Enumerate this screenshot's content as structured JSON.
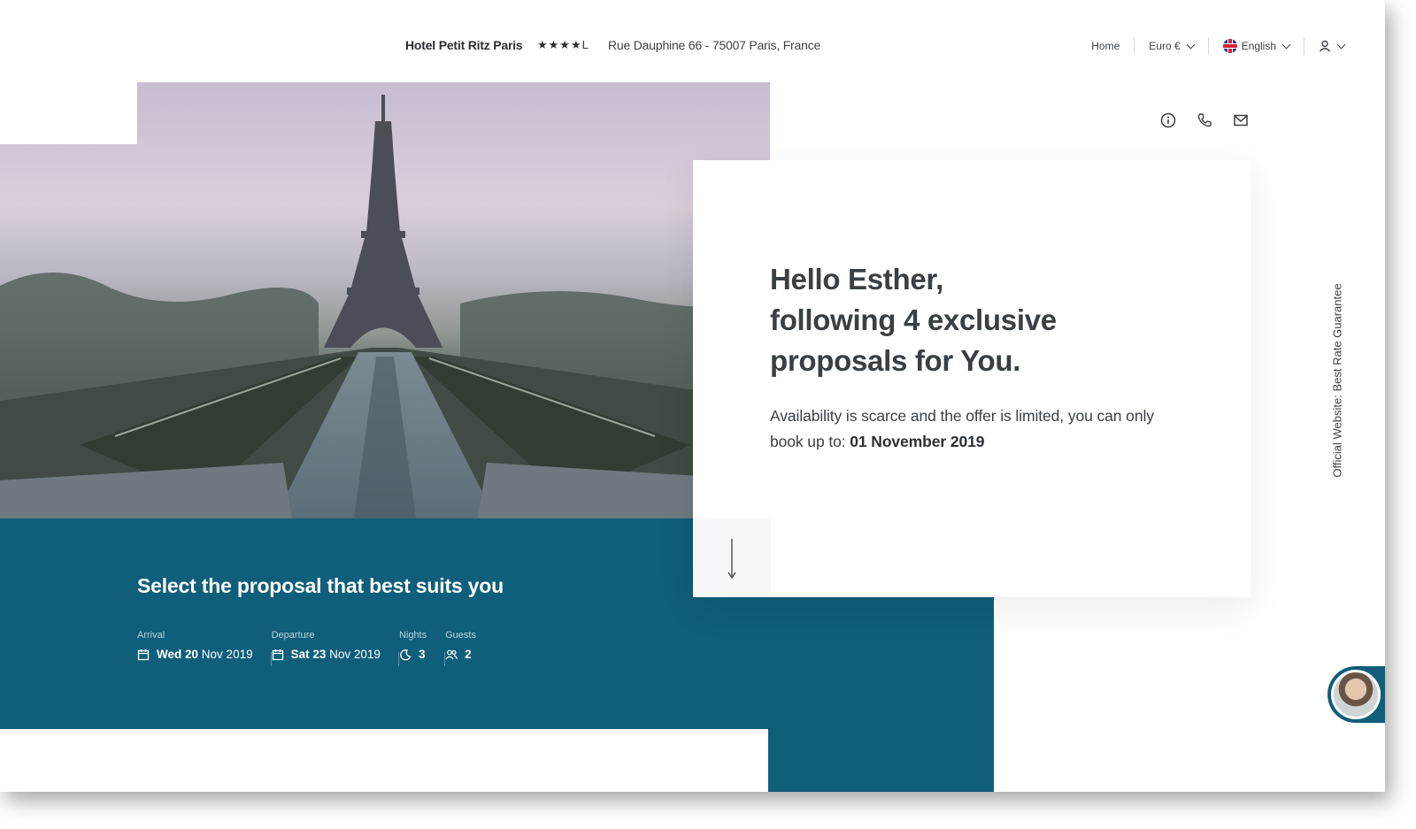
{
  "header": {
    "hotel_name": "Hotel Petit Ritz Paris",
    "stars": "★★★★L",
    "address": "Rue Dauphine 66 - 75007 Paris, France",
    "nav": {
      "home": "Home",
      "currency": "Euro €",
      "language": "English"
    }
  },
  "hero": {
    "image_subject": "Eiffel Tower at dawn",
    "greeting_line1": "Hello Esther,",
    "greeting_line2": "following 4 exclusive",
    "greeting_line3": "proposals for You.",
    "availability_text": "Availability is scarce and the offer is limited, you can only book up to:",
    "availability_date": "01 November 2019"
  },
  "booking": {
    "title": "Select the proposal that best suits you",
    "arrival_label": "Arrival",
    "arrival_day": "Wed 20",
    "arrival_rest": "Nov 2019",
    "departure_label": "Departure",
    "departure_day": "Sat 23",
    "departure_rest": "Nov 2019",
    "nights_label": "Nights",
    "nights_value": "3",
    "guests_label": "Guests",
    "guests_value": "2"
  },
  "side": {
    "vertical_text": "Official Website: Best Rate Guarantee"
  },
  "colors": {
    "teal": "#0f5e7a",
    "text_dark": "#3a3f44"
  },
  "icons": [
    "info-icon",
    "phone-icon",
    "mail-icon",
    "user-icon",
    "chevron-down-icon",
    "calendar-icon",
    "moon-icon",
    "guests-icon",
    "arrow-down-icon",
    "uk-flag-icon"
  ]
}
